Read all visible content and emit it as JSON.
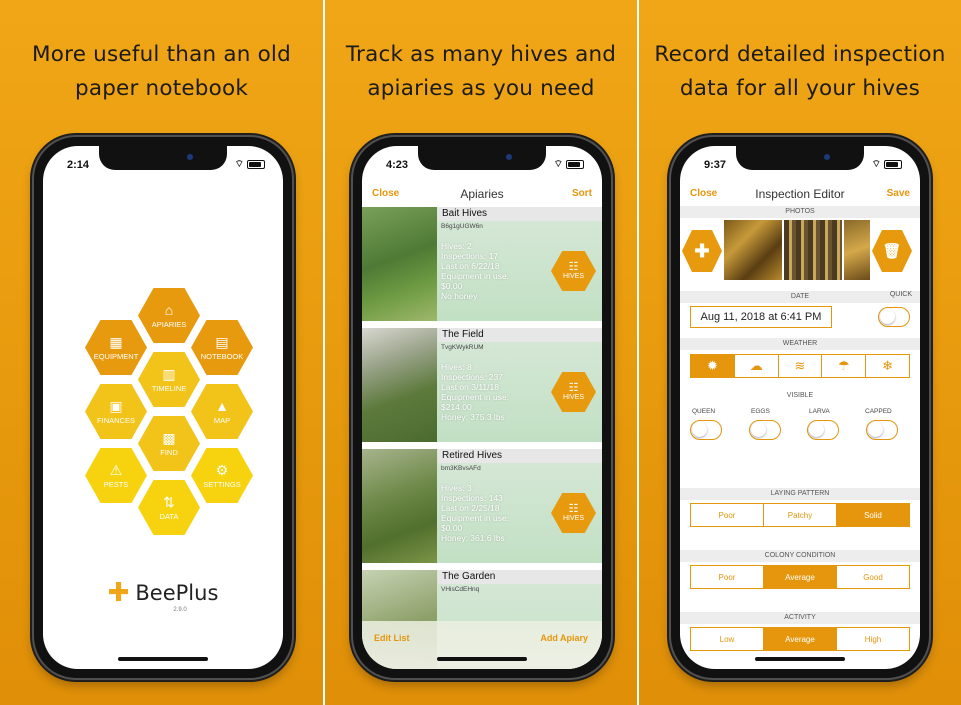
{
  "panels": [
    {
      "caption_line1": "More useful than an old",
      "caption_line2": "paper notebook",
      "status_time": "2:14"
    },
    {
      "caption_line1": "Track as many hives and",
      "caption_line2": "apiaries as you need",
      "status_time": "4:23"
    },
    {
      "caption_line1": "Record detailed inspection",
      "caption_line2": "data for all your hives",
      "status_time": "9:37"
    }
  ],
  "home_menu": {
    "apiaries": "APIARIES",
    "equipment": "EQUIPMENT",
    "notebook": "NOTEBOOK",
    "timeline": "TIMELINE",
    "finances": "FINANCES",
    "map": "MAP",
    "find": "FIND",
    "pests": "PESTS",
    "settings": "SETTINGS",
    "data": "DATA",
    "brand": "BeePlus",
    "version": "2.9.0"
  },
  "apiaries_screen": {
    "close": "Close",
    "title": "Apiaries",
    "sort": "Sort",
    "hives_button": "HIVES",
    "edit_list": "Edit List",
    "add_apiary": "Add Apiary",
    "items": [
      {
        "name": "Bait Hives",
        "code": "B6g1gUGW6n",
        "hives": "Hives: 2",
        "inspections": "Inspections: 17",
        "last": "Last on 6/22/18",
        "equipment_label": "Equipment in use:",
        "equipment_value": "$0.00",
        "honey": "No honey"
      },
      {
        "name": "The Field",
        "code": "TvgKWykRUM",
        "hives": "Hives: 8",
        "inspections": "Inspections: 237",
        "last": "Last on 3/11/18",
        "equipment_label": "Equipment in use:",
        "equipment_value": "$214.00",
        "honey": "Honey: 375.3 lbs"
      },
      {
        "name": "Retired Hives",
        "code": "bm3KBvsAFd",
        "hives": "Hives: 3",
        "inspections": "Inspections: 143",
        "last": "Last on 2/25/18",
        "equipment_label": "Equipment in use:",
        "equipment_value": "$0.00",
        "honey": "Honey: 361.6 lbs"
      },
      {
        "name": "The Garden",
        "code": "VHisCdEHnq"
      }
    ]
  },
  "inspection_screen": {
    "close": "Close",
    "title": "Inspection Editor",
    "save": "Save",
    "photos_header": "PHOTOS",
    "date_header": "DATE",
    "quick_header": "QUICK",
    "date_value": "Aug 11, 2018 at 6:41 PM",
    "weather_header": "WEATHER",
    "visible_header": "VISIBLE",
    "visible_items": [
      "QUEEN",
      "EGGS",
      "LARVA",
      "CAPPED"
    ],
    "laying_header": "LAYING PATTERN",
    "laying_options": [
      "Poor",
      "Patchy",
      "Solid"
    ],
    "laying_selected_index": 2,
    "colony_header": "COLONY CONDITION",
    "colony_options": [
      "Poor",
      "Average",
      "Good"
    ],
    "colony_selected_index": 1,
    "activity_header": "ACTIVITY",
    "activity_options": [
      "Low",
      "Average",
      "High"
    ],
    "activity_selected_index": 1
  },
  "colors": {
    "accent": "#e5960d",
    "hex_orange": "#e89a0f",
    "hex_yellow": "#f2c318",
    "background_orange": "#f0a617"
  },
  "icons": {
    "add_photo": "plus-icon",
    "delete_photo": "trash-icon",
    "weather": [
      "sun-icon",
      "cloud-icon",
      "wind-icon",
      "rain-icon",
      "snow-icon"
    ]
  }
}
